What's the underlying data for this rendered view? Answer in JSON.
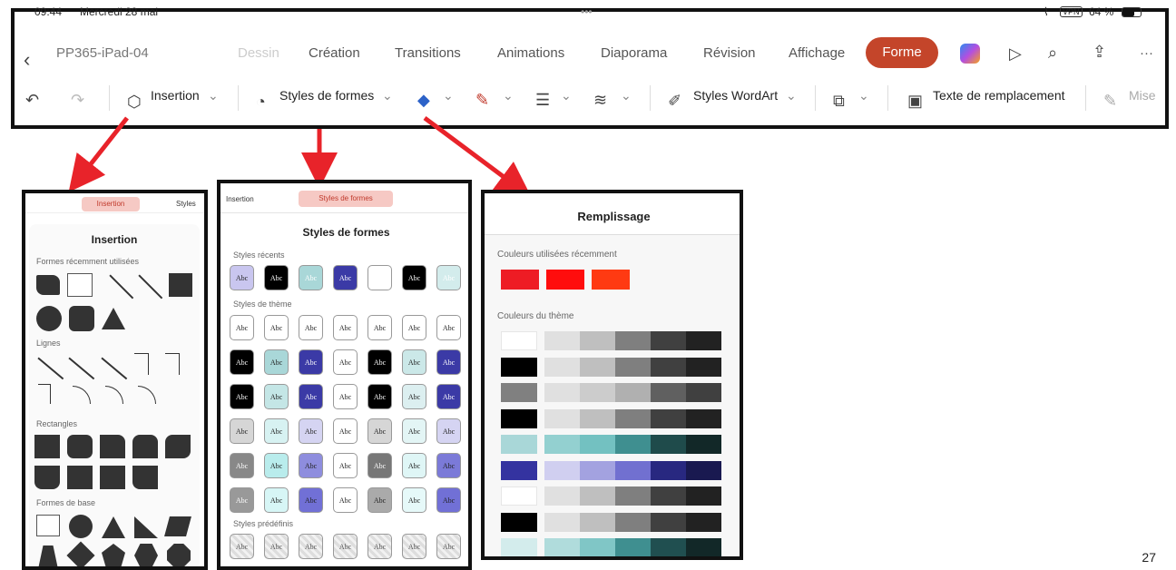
{
  "status": {
    "time": "09:44",
    "date": "Mercredi 28 mai",
    "dots": "•••",
    "vpn": "VPN",
    "battery": "64 %"
  },
  "toolbar": {
    "doc_title": "PP365-iPad-04",
    "tabs": [
      "Dessin",
      "Création",
      "Transitions",
      "Animations",
      "Diaporama",
      "Révision",
      "Affichage"
    ],
    "active_tab": "Forme",
    "more": "···",
    "ribbon": {
      "insertion": "Insertion",
      "styles_formes": "Styles de formes",
      "styles_wordart": "Styles WordArt",
      "texte_remplacement": "Texte de remplacement",
      "mise": "Mise"
    }
  },
  "insertion_panel": {
    "mini_insertion": "Insertion",
    "mini_styles": "Styles",
    "title": "Insertion",
    "sections": [
      "Formes récemment utilisées",
      "Lignes",
      "Rectangles",
      "Formes de base"
    ]
  },
  "styles_panel": {
    "mini_insertion": "Insertion",
    "mini_styles": "Styles de formes",
    "title": "Styles de formes",
    "sections": [
      "Styles récents",
      "Styles de thème",
      "Styles prédéfinis"
    ],
    "abc": "Abc",
    "recent_styles": [
      {
        "bg": "#c9c6ef",
        "fg": "#222"
      },
      {
        "bg": "#000000",
        "fg": "#fff"
      },
      {
        "bg": "#a9d7d8",
        "fg": "#fff"
      },
      {
        "bg": "#3b3aa6",
        "fg": "#fff"
      },
      {
        "bg": "#ffffff",
        "fg": "#fff"
      },
      {
        "bg": "#000000",
        "fg": "#fff"
      },
      {
        "bg": "#d3ecec",
        "fg": "#fff"
      }
    ],
    "theme_rows": [
      [
        "#fff",
        "#fff",
        "#fff",
        "#fff",
        "#fff",
        "#fff",
        "#fff"
      ],
      [
        "#000",
        "#a9d7d8",
        "#3b3aa6",
        "#fff",
        "#000",
        "#cbe8e8",
        "#3b3aa6"
      ],
      [
        "#000",
        "#c4e6e6",
        "#3b3aa6",
        "#fff",
        "#000",
        "#dceff0",
        "#3b3aa6"
      ],
      [
        "#d6d6d6",
        "#d7f2f2",
        "#d5d4f2",
        "#fff",
        "#d6d6d6",
        "#e3f5f5",
        "#d5d4f2"
      ],
      [
        "#888",
        "#b9ecec",
        "#8e8dde",
        "#fff",
        "#777",
        "#dff6f6",
        "#7b7ad8"
      ],
      [
        "#999",
        "#d7f6f6",
        "#7170d6",
        "#fff",
        "#aaa",
        "#e6f9f9",
        "#7170d6"
      ]
    ]
  },
  "fill_panel": {
    "title": "Remplissage",
    "recent_label": "Couleurs utilisées récemment",
    "recent_colors": [
      "#ee1c24",
      "#ff0d0d",
      "#ff3a12"
    ],
    "theme_label": "Couleurs du thème",
    "theme_rows": [
      [
        "#ffffff",
        "#e0e0e0",
        "#bfbfbf",
        "#7f7f7f",
        "#404040",
        "#222222"
      ],
      [
        "#000000",
        "#e0e0e0",
        "#bfbfbf",
        "#7f7f7f",
        "#404040",
        "#222222"
      ],
      [
        "#808080",
        "#e0e0e0",
        "#cccccc",
        "#b0b0b0",
        "#606060",
        "#404040"
      ],
      [
        "#000000",
        "#e0e0e0",
        "#bfbfbf",
        "#7f7f7f",
        "#404040",
        "#222222"
      ],
      [
        "#a9d7d8",
        "#93d0d0",
        "#73c1c1",
        "#3f8f90",
        "#1f4b4b",
        "#122828"
      ],
      [
        "#3433a0",
        "#d0cff0",
        "#a3a2e0",
        "#7170d0",
        "#282880",
        "#191950"
      ],
      [
        "#ffffff",
        "#e0e0e0",
        "#bfbfbf",
        "#7f7f7f",
        "#404040",
        "#222222"
      ],
      [
        "#000000",
        "#e0e0e0",
        "#bfbfbf",
        "#7f7f7f",
        "#404040",
        "#222222"
      ],
      [
        "#d3ecec",
        "#b0dcdc",
        "#80c6c6",
        "#3f8f90",
        "#204f50",
        "#122828"
      ]
    ]
  },
  "page_number": "27"
}
